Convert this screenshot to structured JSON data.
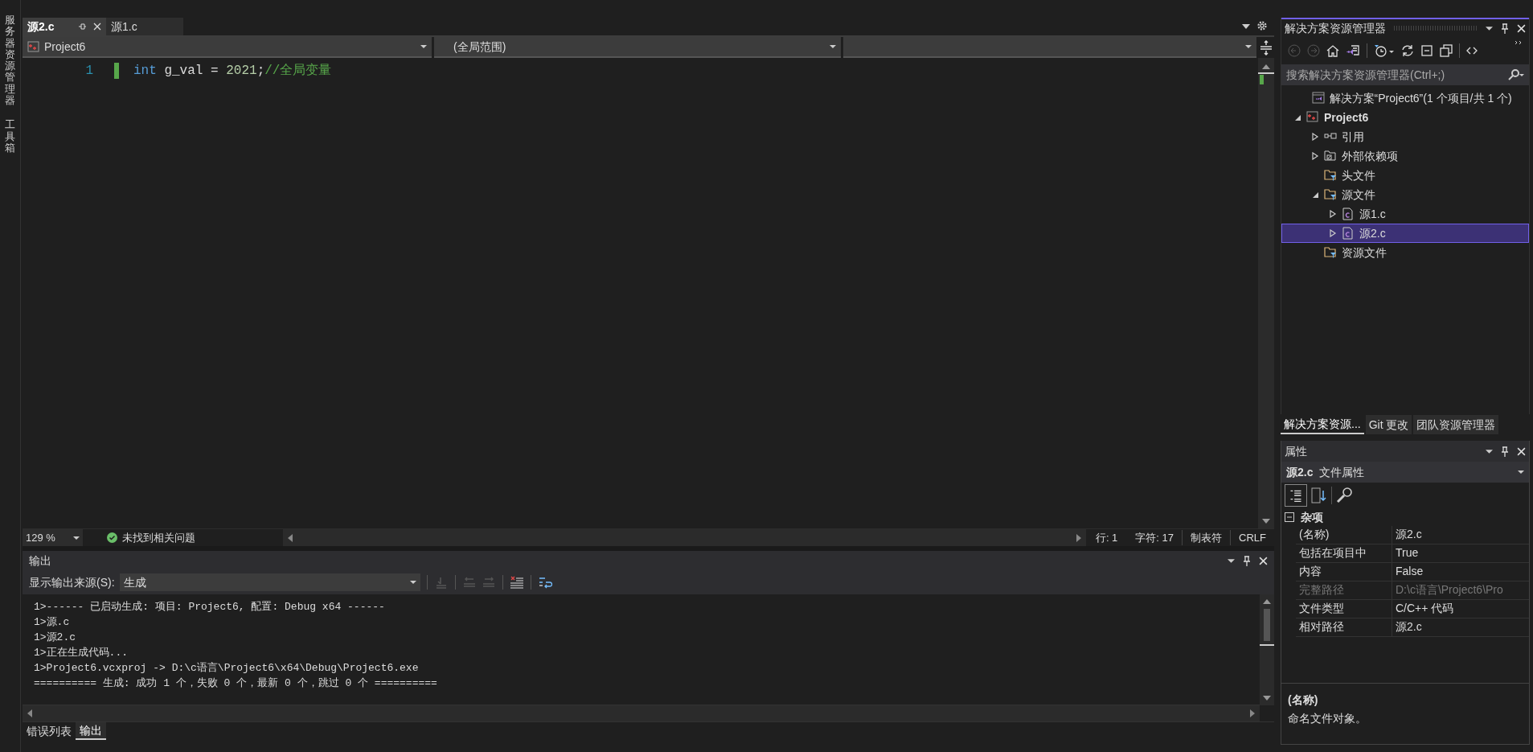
{
  "left_strip": [
    {
      "label": "服务器资源管理器"
    },
    {
      "label": "工具箱"
    }
  ],
  "editor": {
    "tabs": [
      {
        "label": "源2.c",
        "selected": true
      },
      {
        "label": "源1.c",
        "selected": false
      }
    ],
    "nav": [
      {
        "label": "Project6",
        "kind": "project"
      },
      {
        "label": "(全局范围)",
        "kind": "scope"
      }
    ],
    "lines": [
      {
        "number": "1",
        "tokens": [
          {
            "kind": "keyword",
            "text": "int"
          },
          {
            "kind": "plain",
            "text": " g_val = "
          },
          {
            "kind": "number",
            "text": "2021"
          },
          {
            "kind": "plain",
            "text": ";"
          },
          {
            "kind": "comment",
            "text": "//全局变量"
          }
        ]
      }
    ],
    "status": {
      "zoom": "129 %",
      "issues": "未找到相关问题",
      "line": "行: 1",
      "char": "字符: 17",
      "indent": "制表符",
      "eol": "CRLF"
    }
  },
  "output": {
    "title": "输出",
    "source_label": "显示输出来源(S):",
    "source": "生成",
    "lines": [
      "1>------ 已启动生成: 项目: Project6, 配置: Debug x64 ------",
      "1>源.c",
      "1>源2.c",
      "1>正在生成代码...",
      "1>Project6.vcxproj -> D:\\c语言\\Project6\\x64\\Debug\\Project6.exe",
      "========== 生成: 成功 1 个，失败 0 个，最新 0 个，跳过 0 个 =========="
    ]
  },
  "bottom_tabs": [
    {
      "label": "错误列表",
      "selected": false
    },
    {
      "label": "输出",
      "selected": true
    }
  ],
  "solution_explorer": {
    "title": "解决方案资源管理器",
    "search": {
      "placeholder": "搜索解决方案资源管理器(Ctrl+;)"
    },
    "tree": [
      {
        "label": "解决方案“Project6”(1 个项目/共 1 个)",
        "kind": "solution",
        "selected": false
      },
      {
        "label": "Project6",
        "kind": "project",
        "selected": false,
        "expanded": true,
        "children": [
          {
            "label": "引用",
            "kind": "references",
            "selected": false,
            "expanded": false
          },
          {
            "label": "外部依赖项",
            "kind": "external",
            "selected": false,
            "expanded": false
          },
          {
            "label": "头文件",
            "kind": "filter",
            "selected": false
          },
          {
            "label": "源文件",
            "kind": "filter",
            "selected": false,
            "expanded": true,
            "children": [
              {
                "label": "源1.c",
                "kind": "cfile",
                "selected": false,
                "expanded": false
              },
              {
                "label": "源2.c",
                "kind": "cfile",
                "selected": true,
                "expanded": false
              }
            ]
          },
          {
            "label": "资源文件",
            "kind": "filter",
            "selected": false
          }
        ]
      }
    ]
  },
  "right_tabs": [
    {
      "label": "解决方案资源...",
      "selected": true
    },
    {
      "label": "Git 更改",
      "selected": false
    },
    {
      "label": "团队资源管理器",
      "selected": false
    }
  ],
  "properties": {
    "title": "属性",
    "object": "源2.c",
    "object_type": "文件属性",
    "category": {
      "label": "杂项",
      "expanded": true
    },
    "rows": [
      {
        "name": "(名称)",
        "value": "源2.c",
        "disabled": false
      },
      {
        "name": "包括在项目中",
        "value": "True",
        "disabled": false
      },
      {
        "name": "内容",
        "value": "False",
        "disabled": false
      },
      {
        "name": "完整路径",
        "value": "D:\\c语言\\Project6\\Pro",
        "disabled": true
      },
      {
        "name": "文件类型",
        "value": "C/C++ 代码",
        "disabled": false
      },
      {
        "name": "相对路径",
        "value": "源2.c",
        "disabled": false
      }
    ],
    "description": {
      "title": "(名称)",
      "text": "命名文件对象。"
    }
  }
}
